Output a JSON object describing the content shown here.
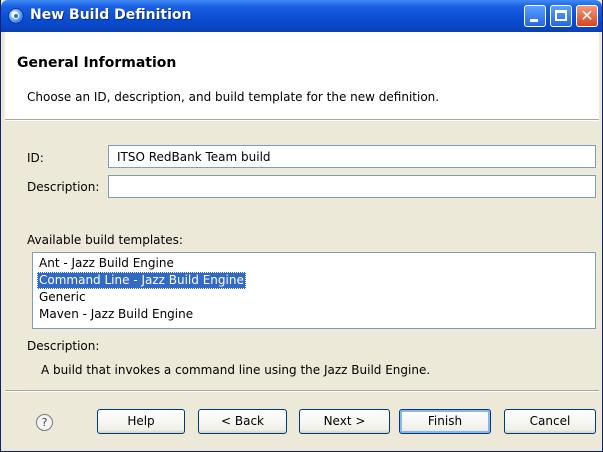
{
  "window": {
    "title": "New Build Definition"
  },
  "header": {
    "title": "General Information",
    "description": "Choose an ID, description, and build template for the new definition."
  },
  "form": {
    "id_label": "ID:",
    "id_value": "ITSO RedBank Team build",
    "description_label": "Description:",
    "description_value": ""
  },
  "templates": {
    "label": "Available build templates:",
    "items": [
      {
        "label": "Ant - Jazz Build Engine",
        "selected": false
      },
      {
        "label": "Command Line - Jazz Build Engine",
        "selected": true
      },
      {
        "label": "Generic",
        "selected": false
      },
      {
        "label": "Maven - Jazz Build Engine",
        "selected": false
      }
    ],
    "description_label": "Description:",
    "description_text": "A build that invokes a command line using the Jazz Build Engine."
  },
  "footer": {
    "help_icon": "question-mark-icon",
    "help_label": "Help",
    "back_label": "< Back",
    "next_label": "Next >",
    "finish_label": "Finish",
    "cancel_label": "Cancel"
  },
  "colors": {
    "titlebar": "#0a4fd6",
    "dialog_bg": "#ece9d8",
    "selection": "#316ac5",
    "field_border": "#7f9db9"
  }
}
